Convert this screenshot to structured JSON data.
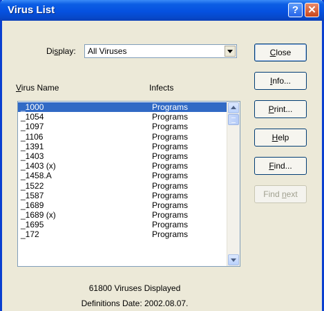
{
  "window": {
    "title": "Virus List"
  },
  "display": {
    "label_pre": "Di",
    "label_key": "s",
    "label_post": "play:",
    "value": "All Viruses"
  },
  "columns": {
    "name_key": "V",
    "name_rest": "irus Name",
    "infects": "Infects"
  },
  "rows": [
    {
      "name": "_1000",
      "infects": "Programs"
    },
    {
      "name": "_1054",
      "infects": "Programs"
    },
    {
      "name": "_1097",
      "infects": "Programs"
    },
    {
      "name": "_1106",
      "infects": "Programs"
    },
    {
      "name": "_1391",
      "infects": "Programs"
    },
    {
      "name": "_1403",
      "infects": "Programs"
    },
    {
      "name": "_1403 (x)",
      "infects": "Programs"
    },
    {
      "name": "_1458.A",
      "infects": "Programs"
    },
    {
      "name": "_1522",
      "infects": "Programs"
    },
    {
      "name": "_1587",
      "infects": "Programs"
    },
    {
      "name": "_1689",
      "infects": "Programs"
    },
    {
      "name": "_1689 (x)",
      "infects": "Programs"
    },
    {
      "name": "_1695",
      "infects": "Programs"
    },
    {
      "name": "_172",
      "infects": "Programs"
    }
  ],
  "buttons": {
    "close": {
      "key": "C",
      "rest": "lose"
    },
    "info": {
      "key": "I",
      "rest": "nfo..."
    },
    "print": {
      "key": "P",
      "rest": "rint..."
    },
    "help": {
      "key": "H",
      "rest": "elp"
    },
    "find": {
      "key": "F",
      "rest": "ind..."
    },
    "find_next": {
      "pre": "Find ",
      "key": "n",
      "rest": "ext"
    }
  },
  "status": {
    "count": "61800 Viruses Displayed",
    "definitions": "Definitions Date: 2002.08.07."
  }
}
